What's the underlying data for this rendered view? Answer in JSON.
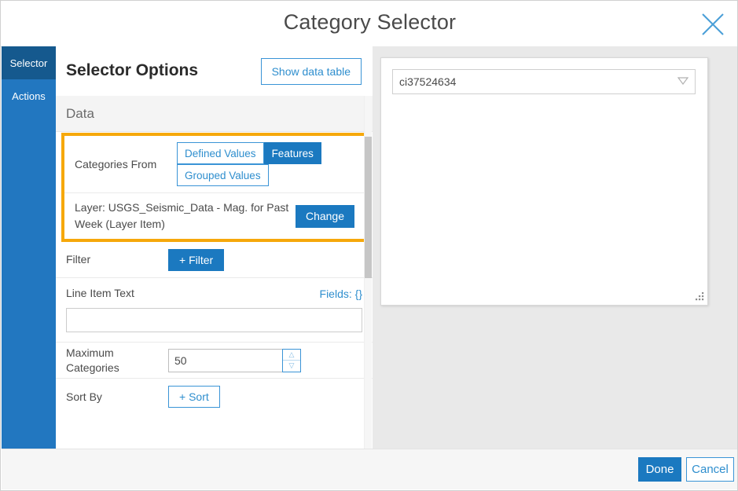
{
  "dialog": {
    "title": "Category Selector",
    "close_icon": "close-icon"
  },
  "sidebar": {
    "tabs": [
      {
        "label": "Selector",
        "active": true
      },
      {
        "label": "Actions",
        "active": false
      }
    ]
  },
  "panel": {
    "title": "Selector Options",
    "show_data_table_label": "Show data table",
    "sections": [
      {
        "label": "Data"
      }
    ],
    "categories_from": {
      "label": "Categories From",
      "options": [
        {
          "label": "Defined Values",
          "selected": false
        },
        {
          "label": "Features",
          "selected": true
        },
        {
          "label": "Grouped Values",
          "selected": false
        }
      ]
    },
    "layer": {
      "text": "Layer: USGS_Seismic_Data - Mag. for Past Week (Layer Item)",
      "change_label": "Change"
    },
    "filter": {
      "label": "Filter",
      "button_label": "+ Filter"
    },
    "line_item_text": {
      "label": "Line Item Text",
      "fields_link": "Fields: {}",
      "value": "",
      "placeholder": ""
    },
    "maximum_categories": {
      "label": "Maximum Categories",
      "value": "50",
      "increment_icon": "triangle-up-icon",
      "decrement_icon": "triangle-down-icon"
    },
    "sort_by": {
      "label": "Sort By",
      "button_label": "+ Sort"
    }
  },
  "preview": {
    "select_value": "ci37524634",
    "dropdown_icon": "chevron-down-icon",
    "resize_icon": "resize-grip-icon"
  },
  "footer": {
    "done_label": "Done",
    "cancel_label": "Cancel"
  },
  "colors": {
    "accent_blue": "#1b79c0",
    "active_tab_blue": "#15598e",
    "rail_blue": "#2277c0",
    "link_blue": "#2e8ece",
    "highlight_gold": "#f6a80b",
    "panel_gray": "#e9e9e9"
  }
}
